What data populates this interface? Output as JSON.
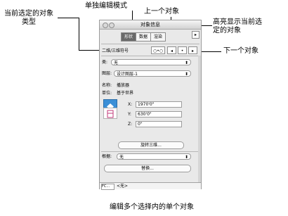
{
  "callouts": {
    "current_object_type": "当前选定的对象\n类型",
    "single_edit_mode": "单独编辑模式",
    "previous_object": "上一个对象",
    "highlight_current": "高亮显示当前选\n定的对象",
    "next_object": "下一个对象",
    "edit_single_in_multi": "编辑多个选择内的单个对象"
  },
  "panel": {
    "window_title": "对象信息",
    "tabs": [
      "形状",
      "数据",
      "渲染"
    ],
    "sidebar_button": "▸",
    "object_type": "二维/三维符号",
    "nav_buttons": [
      "○•○",
      "◂",
      "•",
      "▸"
    ],
    "class_label": "类:",
    "class_value": "无",
    "layer_label": "图层:",
    "layer_value": "设计图层-1",
    "name_label": "名称:",
    "name_value": "播放器",
    "units_label": "单位:",
    "units_value": "基于世界",
    "x_label": "X:",
    "x_value": "1970'0\"",
    "y_label": "Y:",
    "y_value": "630'0\"",
    "z_label": "Z:",
    "z_value": "0\"",
    "rotate_button": "旋转三维...",
    "replace_label": "根据:",
    "replace_value": "无",
    "replace_button": "替换...",
    "status_field": "FC...",
    "status_text": "<无>"
  }
}
